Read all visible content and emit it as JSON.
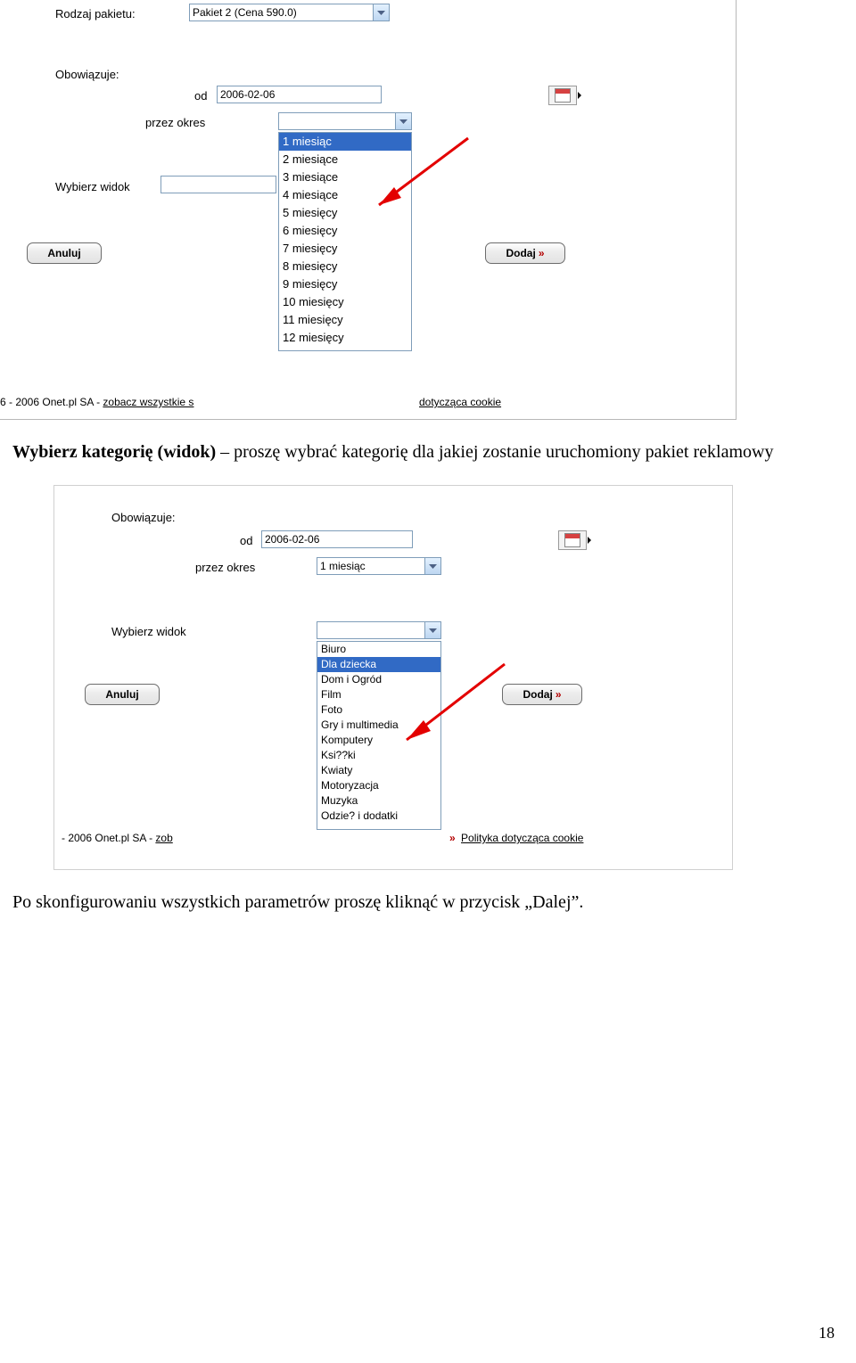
{
  "shot1": {
    "package_label": "Rodzaj pakietu:",
    "package_value": "Pakiet 2 (Cena 590.0)",
    "valid_label": "Obowiązuje:",
    "from_label": "od",
    "from_value": "2006-02-06",
    "period_label": "przez okres",
    "view_label": "Wybierz widok",
    "months": [
      "1 miesiąc",
      "2 miesiące",
      "3 miesiące",
      "4 miesiące",
      "5 miesięcy",
      "6 miesięcy",
      "7 miesięcy",
      "8 miesięcy",
      "9 miesięcy",
      "10 miesięcy",
      "11 miesięcy",
      "12 miesięcy"
    ],
    "cancel": "Anuluj",
    "add": "Dodaj",
    "footer_left": "6 - 2006 Onet.pl SA - ",
    "footer_link_left": "zobacz wszystkie s",
    "footer_right": "dotycząca cookie"
  },
  "para1_strong": "Wybierz kategorię (widok)",
  "para1_rest": " – proszę wybrać kategorię dla jakiej zostanie uruchomiony pakiet reklamowy",
  "shot2": {
    "valid_label": "Obowiązuje:",
    "from_label": "od",
    "from_value": "2006-02-06",
    "period_label": "przez okres",
    "period_value": "1 miesiąc",
    "view_label": "Wybierz widok",
    "categories": [
      "Biuro",
      "Dla dziecka",
      "Dom i Ogród",
      "Film",
      "Foto",
      "Gry i multimedia",
      "Komputery",
      "Ksi??ki",
      "Kwiaty",
      "Motoryzacja",
      "Muzyka",
      "Odzie? i dodatki"
    ],
    "cancel": "Anuluj",
    "add": "Dodaj",
    "footer_left": " - 2006 Onet.pl SA - ",
    "footer_link_left": "zob",
    "footer_link_right": "Polityka dotycząca cookie"
  },
  "para2": "Po skonfigurowaniu wszystkich parametrów proszę kliknąć w przycisk „Dalej”.",
  "page_number": "18"
}
